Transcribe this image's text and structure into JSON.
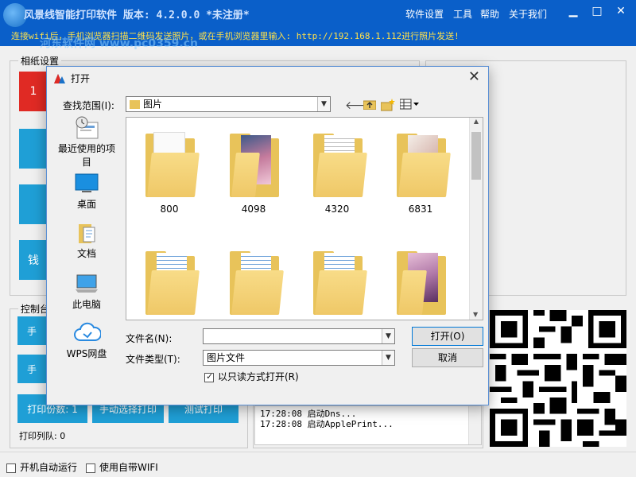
{
  "app": {
    "title": "风景线智能打印软件  版本: 4.2.0.0 *未注册*",
    "menu": [
      "软件设置",
      "工具",
      "帮助",
      "关于我们"
    ],
    "notice": "连接wifi后，手机浏览器扫描二维码发送照片，或在手机浏览器里输入: http://192.168.1.112进行照片发送!",
    "watermark": "河东软件网 www.pc0359.cn",
    "paper_group": "相纸设置",
    "paper_btn_1": "1",
    "paper_btn_4": "钱",
    "control_group": "控制台",
    "ctrl_btn_1": "手",
    "ctrl_btn_2": "手",
    "print_copies": "打印份数: 1",
    "manual_select": "手动选择打印",
    "test_print": "测试打印",
    "queue": "打印列队: 0",
    "log": [
      {
        "time": "17:28:08",
        "msg": "启动Dns..."
      },
      {
        "time": "17:28:08",
        "msg": "启动ApplePrint..."
      }
    ],
    "bottom": {
      "autostart": "开机自动运行",
      "wifi": "使用自带WIFI"
    }
  },
  "dialog": {
    "title": "打开",
    "lookin_label": "查找范围(I):",
    "lookin_value": "图片",
    "places": [
      "最近使用的项目",
      "桌面",
      "文档",
      "此电脑",
      "WPS网盘"
    ],
    "files": [
      "800",
      "4098",
      "4320",
      "6831",
      "",
      "",
      "",
      ""
    ],
    "filename_label": "文件名(N):",
    "filename_value": "",
    "filetype_label": "文件类型(T):",
    "filetype_value": "图片文件",
    "readonly_label": "以只读方式打开(R)",
    "open_btn": "打开(O)",
    "cancel_btn": "取消"
  }
}
